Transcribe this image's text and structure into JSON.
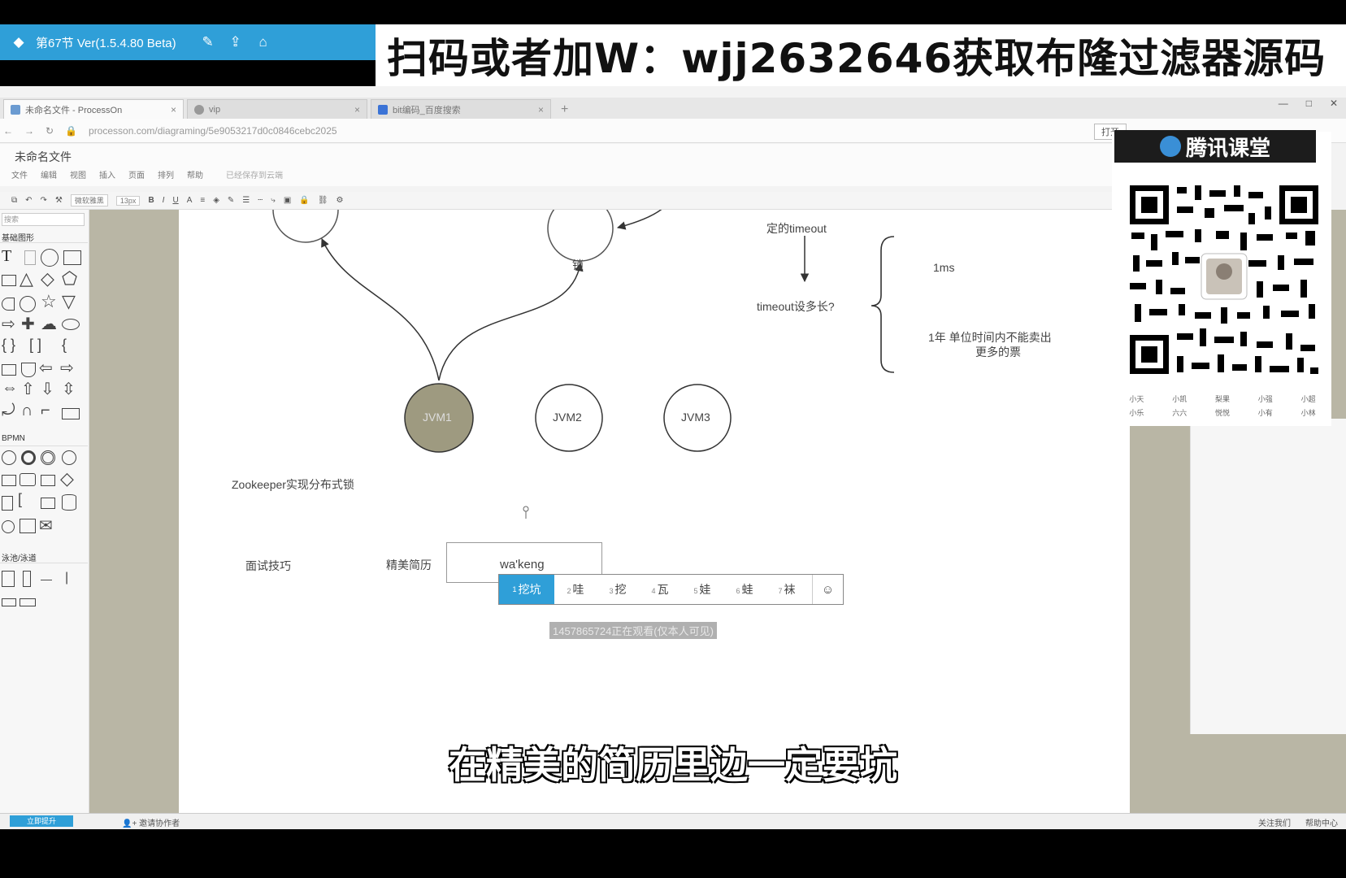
{
  "player": {
    "title": "第67节 Ver(1.5.4.80 Beta)"
  },
  "promo": {
    "text": "扫码或者加W：wjj2632646获取布隆过滤器源码"
  },
  "browser": {
    "tabs": [
      {
        "label": "未命名文件 - ProcessOn"
      },
      {
        "label": "vip"
      },
      {
        "label": "bit编码_百度搜索"
      }
    ],
    "new_tab": "+",
    "url": "processon.com/diagraming/5e9053217d0c0846cebc2025",
    "open_label": "打开"
  },
  "app": {
    "doc_title": "未命名文件",
    "menu": [
      "文件",
      "编辑",
      "视图",
      "插入",
      "页面",
      "排列",
      "帮助"
    ],
    "saved_status": "已经保存到云端",
    "toolbar": {
      "font": "微软雅黑",
      "font_size": "13px"
    },
    "shape_panel": {
      "search_placeholder": "搜索",
      "sections": [
        "基础图形",
        "BPMN",
        "泳池/泳道"
      ]
    }
  },
  "canvas": {
    "top_node": "锁",
    "timeout_label": "定的timeout",
    "timeout_question": "timeout设多长?",
    "option_1ms": "1ms",
    "option_1year_line1": "1年  单位时间内不能卖出",
    "option_1year_line2": "更多的票",
    "jvm_nodes": [
      "JVM1",
      "JVM2",
      "JVM3"
    ],
    "jvm1_fill": "#9e9a80",
    "zookeeper_label": "Zookeeper实现分布式锁",
    "interview_tips": "面试技巧",
    "resume": "精美简历",
    "edit_text": "wa'keng"
  },
  "ime": {
    "candidates": [
      {
        "n": "1",
        "text": "挖坑"
      },
      {
        "n": "2",
        "text": "哇"
      },
      {
        "n": "3",
        "text": "挖"
      },
      {
        "n": "4",
        "text": "瓦"
      },
      {
        "n": "5",
        "text": "娃"
      },
      {
        "n": "6",
        "text": "蛙"
      },
      {
        "n": "7",
        "text": "袜"
      }
    ],
    "emoji": "☺",
    "accent": "#2f9fd8"
  },
  "watch_note": "1457865724正在观看(仅本人可见)",
  "qr": {
    "brand": "腾讯课堂",
    "labels": [
      "小天",
      "小凯",
      "梨果",
      "小强",
      "小超",
      "小乐",
      "六六",
      "悦悦",
      "小有",
      "小林"
    ]
  },
  "statusbar": {
    "button": "立即提升",
    "invite": "邀请协作者",
    "right": [
      "关注我们",
      "帮助中心"
    ]
  },
  "subtitle": "在精美的简历里边一定要坑"
}
